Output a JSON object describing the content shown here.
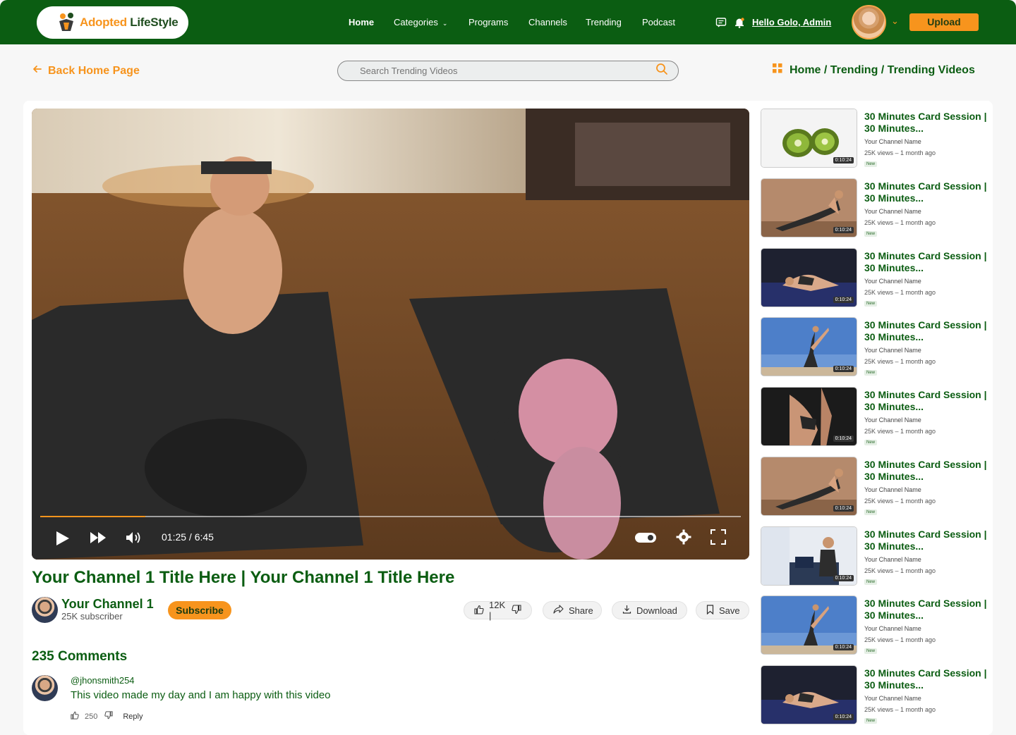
{
  "brand": {
    "part1": "Adopted",
    "part2": " LifeStyle",
    "accent": "#f7941d",
    "primary": "#0b5d12"
  },
  "nav": {
    "items": [
      "Home",
      "Categories",
      "Programs",
      "Channels",
      "Trending",
      "Podcast"
    ],
    "active": "Home",
    "greeting": "Hello Golo, Admin",
    "upload_label": "Upload"
  },
  "page": {
    "back_label": "Back Home Page",
    "search_placeholder": "Search Trending Videos",
    "breadcrumb": "Home / Trending / Trending Videos"
  },
  "player": {
    "time": "01:25 / 6:45",
    "progress_fraction": 0.15
  },
  "video": {
    "title": "Your Channel 1 Title Here | Your Channel 1 Title Here",
    "channel_name": "Your Channel 1",
    "channel_subscribers": "25K subscriber",
    "subscribe_label": "Subscribe",
    "likes": "12K |",
    "share_label": "Share",
    "download_label": "Download",
    "save_label": "Save"
  },
  "comments": {
    "heading": "235 Comments",
    "items": [
      {
        "user": "@jhonsmith254",
        "text": "This video made my day and I am happy with this video",
        "likes": "250",
        "reply": "Reply"
      }
    ]
  },
  "recommended": [
    {
      "title": "30 Minutes Card Session | 30 Minutes...",
      "channel": "Your Channel Name",
      "meta": "25K views  –  1 month ago",
      "badge": "New",
      "duration": "0:10:24",
      "thumb": "kiwi"
    },
    {
      "title": "30 Minutes Card Session | 30 Minutes...",
      "channel": "Your Channel Name",
      "meta": "25K views  –  1 month ago",
      "badge": "New",
      "duration": "0:10:24",
      "thumb": "plank"
    },
    {
      "title": "30 Minutes Card Session | 30 Minutes...",
      "channel": "Your Channel Name",
      "meta": "25K views  –  1 month ago",
      "badge": "New",
      "duration": "0:10:24",
      "thumb": "crunch"
    },
    {
      "title": "30 Minutes Card Session | 30 Minutes...",
      "channel": "Your Channel Name",
      "meta": "25K views  –  1 month ago",
      "badge": "New",
      "duration": "0:10:24",
      "thumb": "beach"
    },
    {
      "title": "30 Minutes Card Session | 30 Minutes...",
      "channel": "Your Channel Name",
      "meta": "25K views  –  1 month ago",
      "badge": "New",
      "duration": "0:10:24",
      "thumb": "dark"
    },
    {
      "title": "30 Minutes Card Session | 30 Minutes...",
      "channel": "Your Channel Name",
      "meta": "25K views  –  1 month ago",
      "badge": "New",
      "duration": "0:10:24",
      "thumb": "plank"
    },
    {
      "title": "30 Minutes Card Session | 30 Minutes...",
      "channel": "Your Channel Name",
      "meta": "25K views  –  1 month ago",
      "badge": "New",
      "duration": "0:10:24",
      "thumb": "gym"
    },
    {
      "title": "30 Minutes Card Session | 30 Minutes...",
      "channel": "Your Channel Name",
      "meta": "25K views  –  1 month ago",
      "badge": "New",
      "duration": "0:10:24",
      "thumb": "beach"
    },
    {
      "title": "30 Minutes Card Session | 30 Minutes...",
      "channel": "Your Channel Name",
      "meta": "25K views  –  1 month ago",
      "badge": "New",
      "duration": "0:10:24",
      "thumb": "crunch"
    }
  ]
}
